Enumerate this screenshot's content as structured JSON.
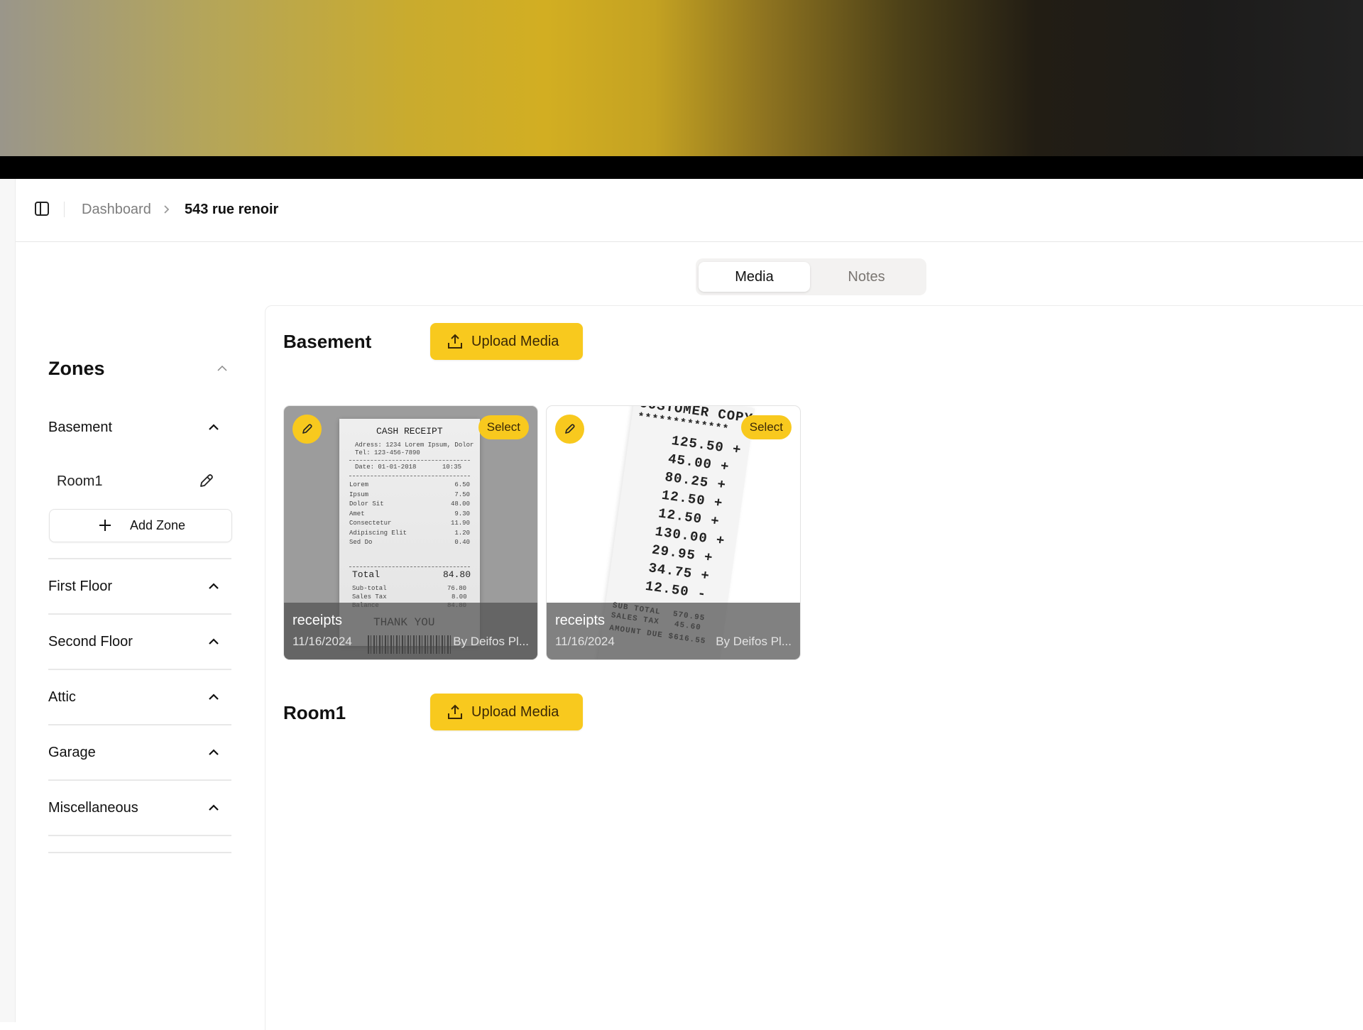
{
  "header": {
    "breadcrumb": [
      {
        "label": "Dashboard"
      },
      {
        "label": "543 rue renoir"
      }
    ]
  },
  "tabs": [
    {
      "label": "Media",
      "active": true
    },
    {
      "label": "Notes",
      "active": false
    }
  ],
  "sidebar": {
    "title": "Zones",
    "zones": [
      {
        "label": "Basement",
        "rooms": [
          {
            "label": "Room1"
          }
        ],
        "add_label": "Add Zone"
      },
      {
        "label": "First Floor"
      },
      {
        "label": "Second Floor"
      },
      {
        "label": "Attic"
      },
      {
        "label": "Garage"
      },
      {
        "label": "Miscellaneous"
      }
    ]
  },
  "main": {
    "sections": [
      {
        "title": "Basement",
        "upload_label": "Upload Media",
        "media": [
          {
            "name": "receipts",
            "date": "11/16/2024",
            "author": "By Deifos Pl...",
            "select_label": "Select",
            "image": {
              "heading": "CASH RECEIPT",
              "address": "Adress: 1234 Lorem Ipsum, Dolor",
              "tel": "Tel: 123-456-7890",
              "date": "Date: 01-01-2018",
              "time": "10:35",
              "items": [
                {
                  "name": "Lorem",
                  "price": "6.50"
                },
                {
                  "name": "Ipsum",
                  "price": "7.50"
                },
                {
                  "name": "Dolor Sit",
                  "price": "48.00"
                },
                {
                  "name": "Amet",
                  "price": "9.30"
                },
                {
                  "name": "Consectetur",
                  "price": "11.90"
                },
                {
                  "name": "Adipiscing Elit",
                  "price": "1.20"
                },
                {
                  "name": "Sed Do",
                  "price": "0.40"
                }
              ],
              "total_label": "Total",
              "total": "84.80",
              "subtotal_label": "Sub-total",
              "subtotal": "76.80",
              "tax_label": "Sales Tax",
              "tax": "8.00",
              "balance_label": "Balance",
              "balance": "84.80",
              "footer": "THANK YOU"
            }
          },
          {
            "name": "receipts",
            "date": "11/16/2024",
            "author": "By Deifos Pl...",
            "select_label": "Select",
            "image": {
              "heading": "CUSTOMER COPY",
              "stars": "*************",
              "lines": [
                "125.50 +",
                "45.00 +",
                "80.25 +",
                "12.50 +",
                "12.50 +",
                "130.00 +",
                "29.95 +",
                "34.75 +",
                "12.50 -"
              ],
              "subtotal_label": "SUB TOTAL",
              "subtotal": "570.95",
              "tax_label": "SALES TAX",
              "tax": "45.60",
              "due_label": "AMOUNT DUE",
              "due": "$616.55"
            }
          }
        ]
      },
      {
        "title": "Room1",
        "upload_label": "Upload Media",
        "media": []
      }
    ]
  },
  "colors": {
    "accent": "#f8c91e",
    "accent_text": "#3a2806",
    "muted_text": "#7d7d7d"
  }
}
